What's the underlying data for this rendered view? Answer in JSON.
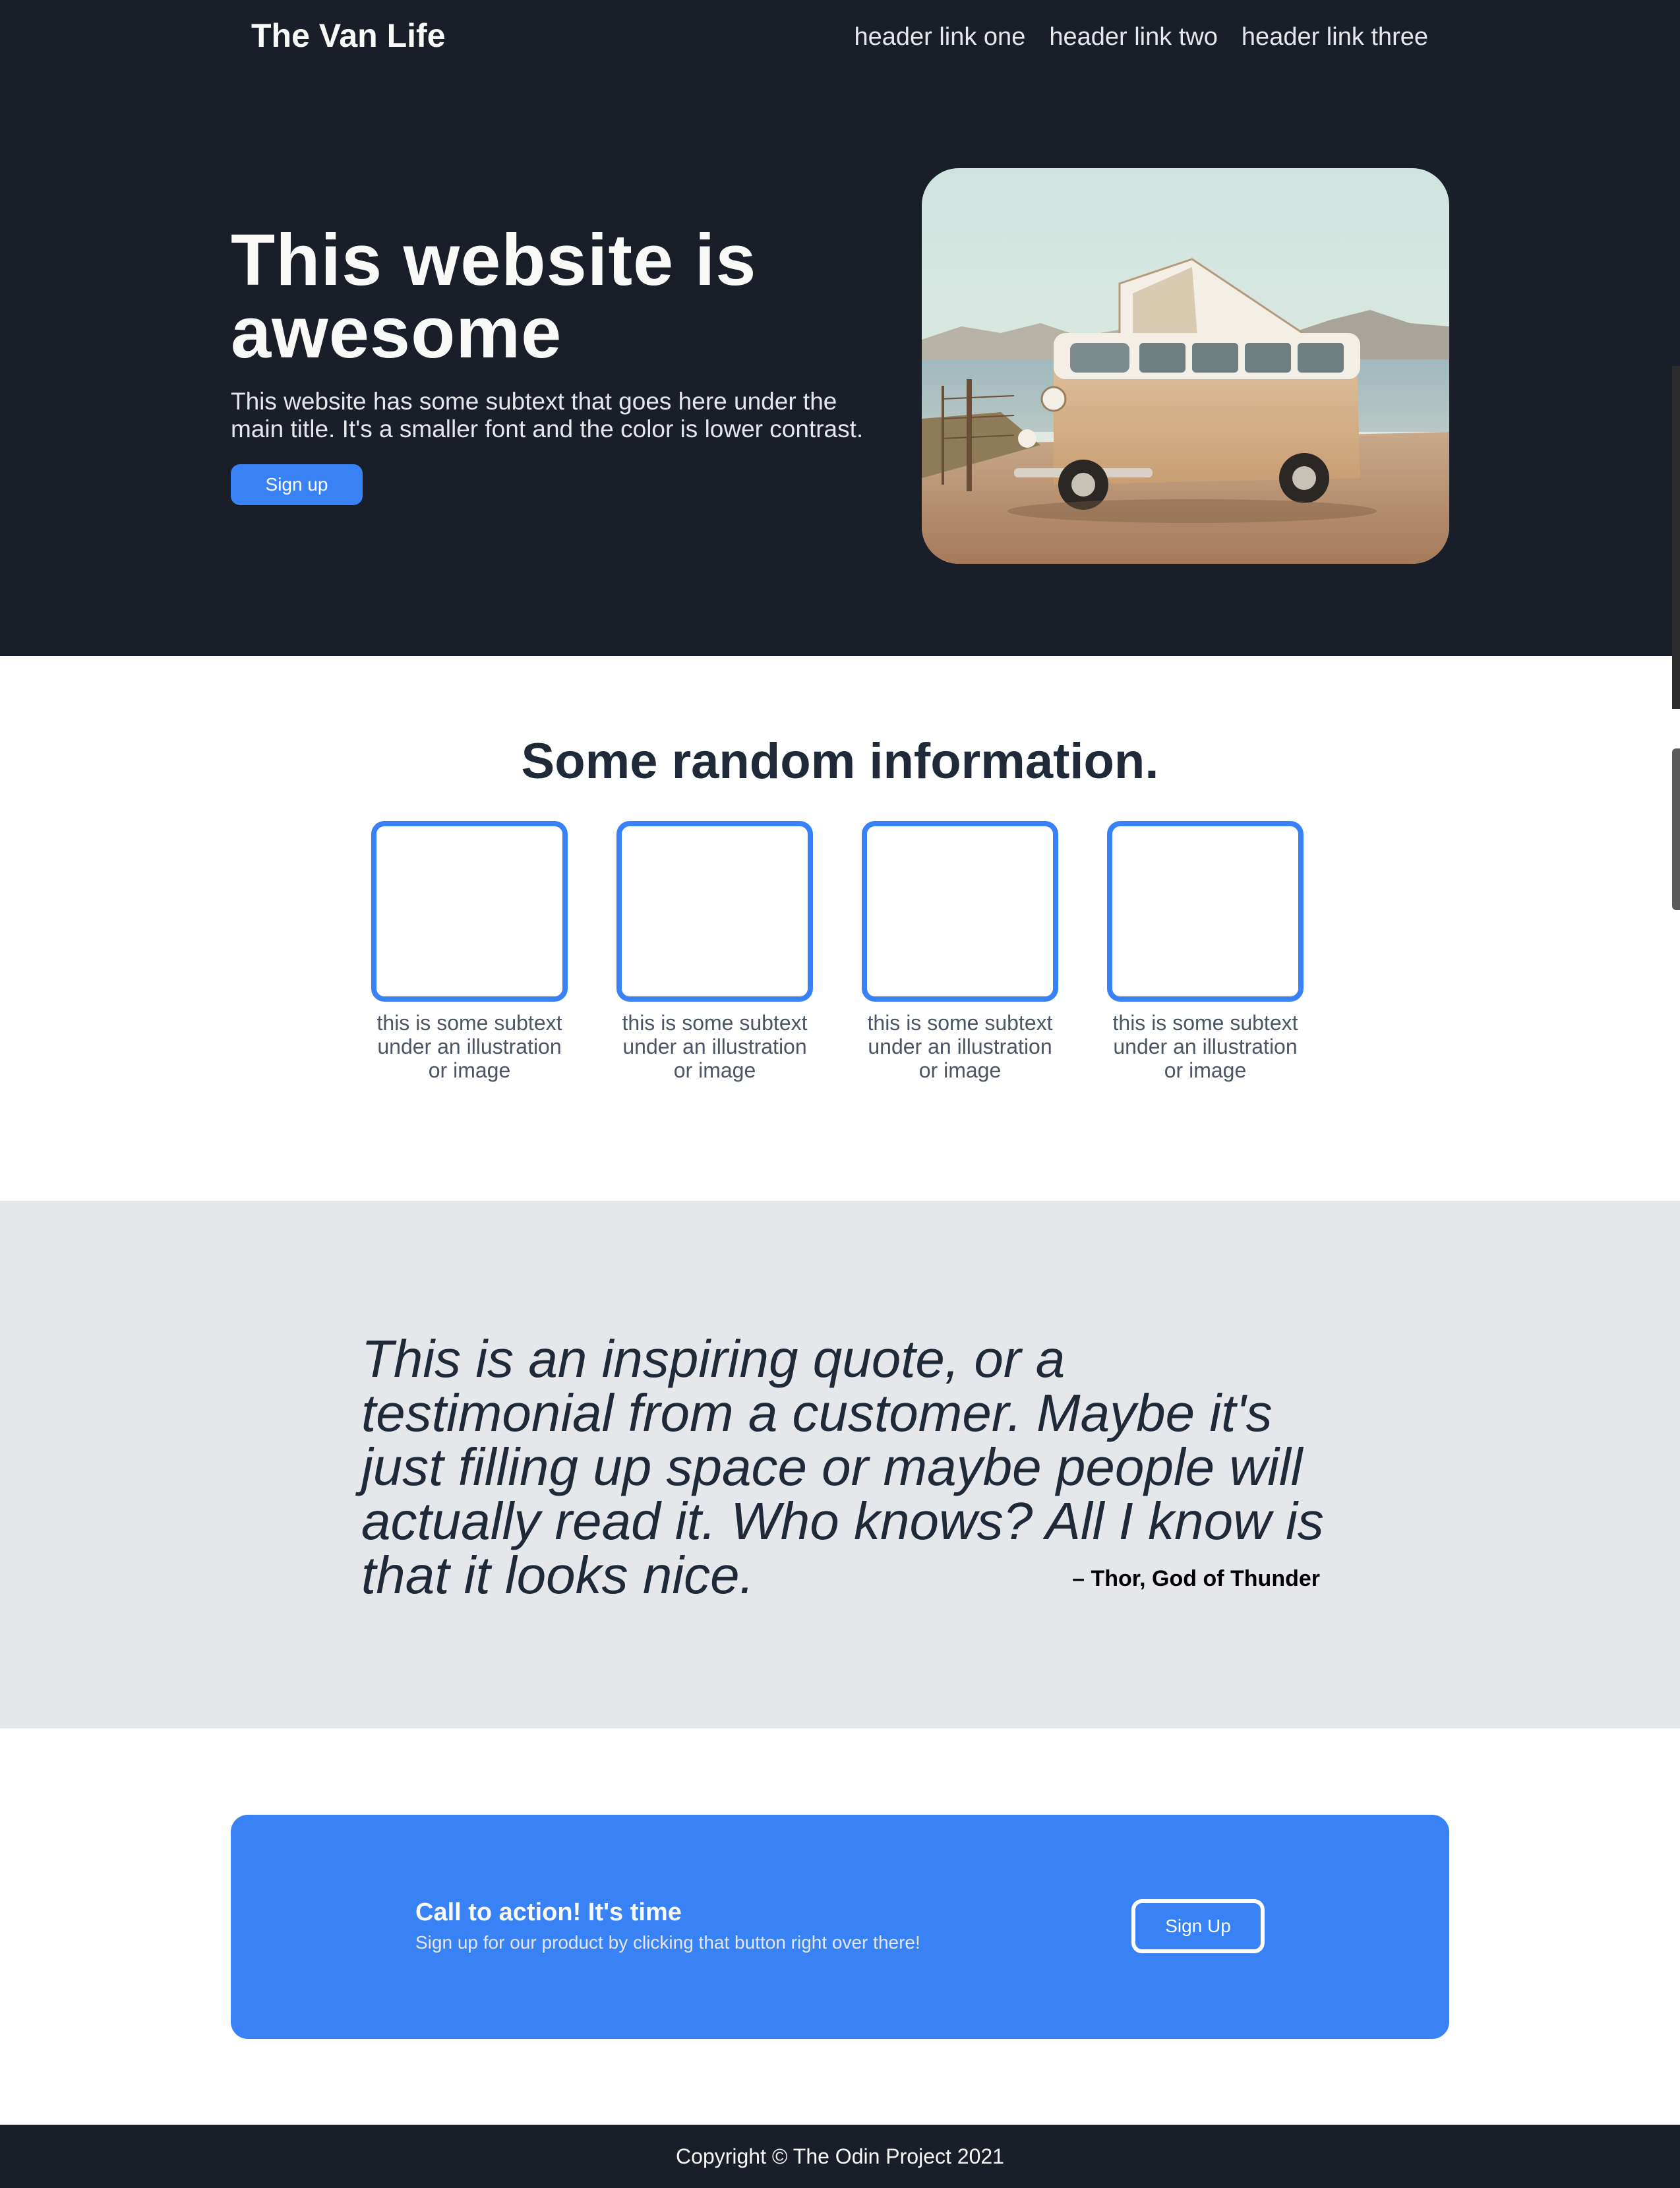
{
  "colors": {
    "dark_bg": "#1a1e29",
    "accent_blue": "#3882f6",
    "light_gray_bg": "#e5e7eb",
    "heading_dark": "#1f2937",
    "caption_gray": "#4b5563",
    "near_white": "#f9faf8"
  },
  "header": {
    "logo": "The Van Life",
    "links": [
      "header link one",
      "header link two",
      "header link three"
    ]
  },
  "hero": {
    "title": "This website is awesome",
    "subtext": "This website has some subtext that goes here under the main title. It's a smaller font and the color is lower contrast.",
    "button_label": "Sign up",
    "image_icon": "camper-van-photo"
  },
  "info": {
    "title": "Some random information.",
    "cards": [
      {
        "caption": "this is some subtext under an illustration or image"
      },
      {
        "caption": "this is some subtext under an illustration or image"
      },
      {
        "caption": "this is some subtext under an illustration or image"
      },
      {
        "caption": "this is some subtext under an illustration or image"
      }
    ]
  },
  "quote": {
    "text": "This is an inspiring quote, or a testimonial from a customer. Maybe it's just filling up space or maybe people will actually read it. Who knows? All I know is that it looks nice.",
    "author": "– Thor, God of Thunder"
  },
  "cta": {
    "heading": "Call to action! It's time",
    "subtext": "Sign up for our product by clicking that button right over there!",
    "button_label": "Sign Up"
  },
  "footer": {
    "copyright": "Copyright © The Odin Project 2021"
  }
}
